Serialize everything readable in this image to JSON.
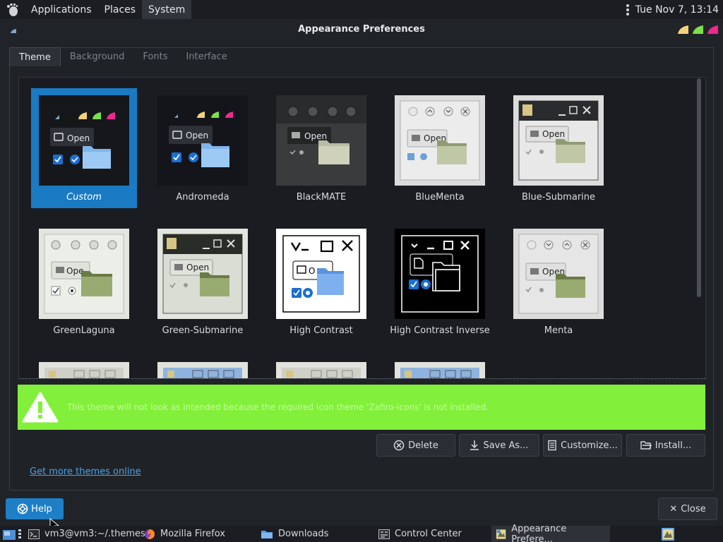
{
  "top_panel": {
    "menus": [
      "Applications",
      "Places",
      "System"
    ],
    "clock": "Tue Nov  7, 13:14"
  },
  "window": {
    "title": "Appearance Preferences"
  },
  "tabs": [
    "Theme",
    "Background",
    "Fonts",
    "Interface"
  ],
  "themes": [
    {
      "name": "Custom",
      "style": "dark",
      "selected": true
    },
    {
      "name": "Andromeda",
      "style": "dark"
    },
    {
      "name": "BlackMATE",
      "style": "black"
    },
    {
      "name": "BlueMenta",
      "style": "light"
    },
    {
      "name": "Blue-Submarine",
      "style": "sub"
    },
    {
      "name": "GreenLaguna",
      "style": "green"
    },
    {
      "name": "Green-Submarine",
      "style": "sub"
    },
    {
      "name": "High Contrast",
      "style": "hc"
    },
    {
      "name": "High Contrast Inverse",
      "style": "hci"
    },
    {
      "name": "Menta",
      "style": "light"
    }
  ],
  "thumbnail": {
    "open_label": "Open",
    "open_label_short": "Ope",
    "open_label_hc": "O"
  },
  "warning": {
    "text": "This theme will not look as intended because the required icon theme 'Zafiro-icons' is not installed."
  },
  "buttons": {
    "delete": "Delete",
    "save_as": "Save As...",
    "customize": "Customize...",
    "install": "Install..."
  },
  "link": "Get more themes online",
  "help": "Help",
  "close": "Close",
  "taskbar": {
    "terminal": "vm3@vm3:~/.themes",
    "firefox": "Mozilla Firefox",
    "downloads": "Downloads",
    "control_center": "Control Center",
    "appearance": "Appearance Prefere..."
  },
  "colors": {
    "selection": "#1a7bc4",
    "warning_bg": "#82f03a",
    "link": "#4aa3e8"
  }
}
